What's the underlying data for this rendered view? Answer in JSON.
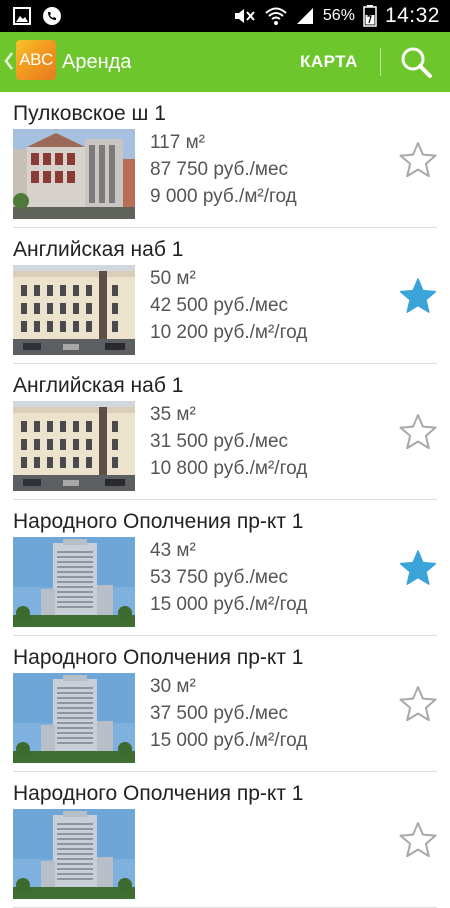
{
  "status_bar": {
    "battery_percent": "56%",
    "time": "14:32",
    "icons": [
      "gallery-icon",
      "viber-icon",
      "mute-icon",
      "wifi-icon",
      "signal-icon",
      "battery-icon"
    ]
  },
  "action_bar": {
    "logo_text": "ABC",
    "title": "Аренда",
    "map_label": "КАРТА",
    "background": "#6cc62c"
  },
  "listings": [
    {
      "title": "Пулковское ш 1",
      "area": "117 м²",
      "price_month": "87 750 руб./мес",
      "price_sqm_year": "9 000 руб./м²/год",
      "favorite": false,
      "image": "modern-building"
    },
    {
      "title": "Английская наб 1",
      "area": "50 м²",
      "price_month": "42 500 руб./мес",
      "price_sqm_year": "10 200 руб./м²/год",
      "favorite": true,
      "image": "classic-building"
    },
    {
      "title": "Английская наб 1",
      "area": "35 м²",
      "price_month": "31 500 руб./мес",
      "price_sqm_year": "10 800 руб./м²/год",
      "favorite": false,
      "image": "classic-building"
    },
    {
      "title": "Народного Ополчения пр-кт 1",
      "area": "43 м²",
      "price_month": "53 750 руб./мес",
      "price_sqm_year": "15 000 руб./м²/год",
      "favorite": true,
      "image": "tower-building"
    },
    {
      "title": "Народного Ополчения пр-кт 1",
      "area": "30 м²",
      "price_month": "37 500 руб./мес",
      "price_sqm_year": "15 000 руб./м²/год",
      "favorite": false,
      "image": "tower-building"
    },
    {
      "title": "Народного Ополчения пр-кт 1",
      "area": "",
      "price_month": "",
      "price_sqm_year": "",
      "favorite": false,
      "image": "tower-building"
    }
  ],
  "colors": {
    "accent_green": "#6cc62c",
    "favorite_blue": "#3aa3d8",
    "star_outline": "#a8a8a8"
  }
}
